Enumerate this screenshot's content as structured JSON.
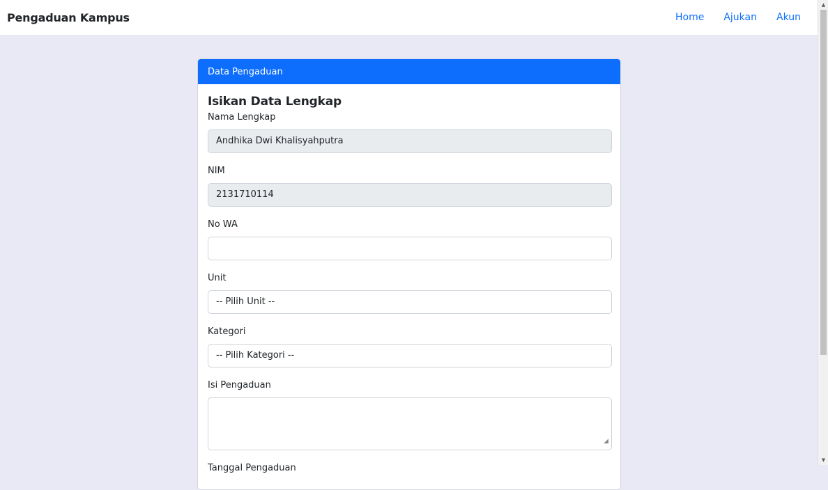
{
  "navbar": {
    "brand": "Pengaduan Kampus",
    "links": [
      "Home",
      "Ajukan",
      "Akun"
    ]
  },
  "card": {
    "header": "Data Pengaduan",
    "title": "Isikan Data Lengkap",
    "fields": {
      "nama": {
        "label": "Nama Lengkap",
        "value": "Andhika Dwi Khalisyahputra"
      },
      "nim": {
        "label": "NIM",
        "value": "2131710114"
      },
      "wa": {
        "label": "No WA",
        "value": ""
      },
      "unit": {
        "label": "Unit",
        "selected": "-- Pilih Unit --"
      },
      "kategori": {
        "label": "Kategori",
        "selected": "-- Pilih Kategori --"
      },
      "isi": {
        "label": "Isi Pengaduan",
        "value": ""
      },
      "tanggal": {
        "label": "Tanggal Pengaduan"
      }
    }
  },
  "colors": {
    "primary": "#0d6efd",
    "page_bg": "#e9e9f5",
    "readonly_bg": "#e9ecef"
  }
}
